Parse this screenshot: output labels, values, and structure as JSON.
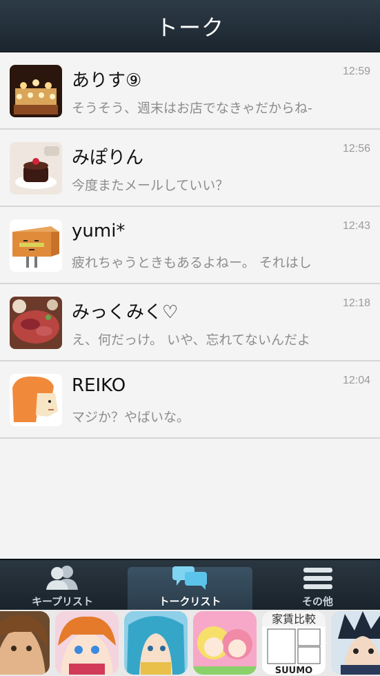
{
  "header": {
    "title": "トーク"
  },
  "talks": [
    {
      "name": "ありす⑨",
      "preview": "そうそう、週末はお店でなきゃだからね-",
      "time": "12:59"
    },
    {
      "name": "みぽりん",
      "preview": "今度またメールしていい？",
      "time": "12:56"
    },
    {
      "name": "yumi*",
      "preview": "疲れちゃうときもあるよねー。 それはし",
      "time": "12:43"
    },
    {
      "name": "みっくみく♡",
      "preview": "え、何だっけ。 いや、忘れてないんだよ",
      "time": "12:18"
    },
    {
      "name": "REIKO",
      "preview": "マジか？やばいな。",
      "time": "12:04"
    }
  ],
  "nav": {
    "items": [
      {
        "label": "キープリスト",
        "icon": "friends-icon"
      },
      {
        "label": "トークリスト",
        "icon": "chat-bubbles-icon"
      },
      {
        "label": "その他",
        "icon": "menu-icon"
      }
    ],
    "active": "トークリスト"
  },
  "ads": {
    "tile5_text_top": "家賃比較",
    "tile5_text_bottom": "SUUMO"
  },
  "colors": {
    "header_bg": "#1f2a33",
    "nav_bg": "#1f2a33",
    "active_tab": "#34495a",
    "list_bg": "#f4f4f4",
    "divider": "#d6d6d6"
  }
}
